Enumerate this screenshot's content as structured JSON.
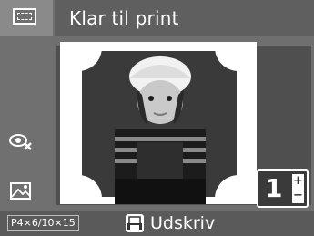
{
  "header": {
    "title": "Klar til print",
    "mode_icon": "frame-layout-icon"
  },
  "sidebar": {
    "icons": [
      "red-eye-correction-icon",
      "image-adjust-icon"
    ]
  },
  "preview": {
    "image": "photo-of-child-with-hat-icon"
  },
  "copies": {
    "value": "1",
    "plus_label": "+",
    "minus_label": "−"
  },
  "footer": {
    "size_label": "P4×6/10×15",
    "print_label": "Udskriv",
    "print_icon": "print-icon"
  },
  "colors": {
    "background": "#6f6f6f",
    "title_bar": "#5f5f5f",
    "bottom_bar": "#5a5a5a",
    "text": "#ffffff"
  }
}
